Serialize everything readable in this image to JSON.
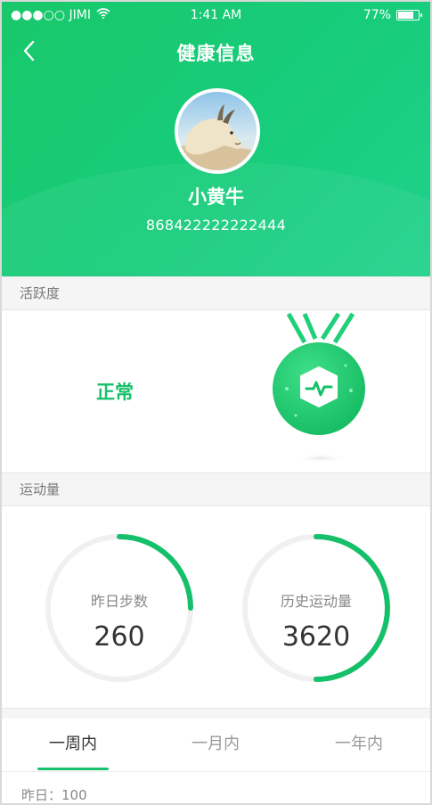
{
  "status_bar": {
    "carrier": "●●●○○ JIMI",
    "time": "1:41 AM",
    "battery": "77%",
    "battery_level": 0.77
  },
  "header": {
    "title": "健康信息",
    "back_icon": "chevron-left-icon"
  },
  "profile": {
    "name": "小黄牛",
    "id": "868422222222444",
    "avatar": "goat-avatar-image"
  },
  "activity": {
    "section_title": "活跃度",
    "status": "正常",
    "medal_icon": "pulse-medal-icon"
  },
  "exercise": {
    "section_title": "运动量",
    "rings": [
      {
        "label": "昨日步数",
        "value": "260",
        "progress": 0.25
      },
      {
        "label": "历史运动量",
        "value": "3620",
        "progress": 0.5
      }
    ]
  },
  "tabs": [
    {
      "label": "一周内",
      "active": true
    },
    {
      "label": "一月内",
      "active": false
    },
    {
      "label": "一年内",
      "active": false
    }
  ],
  "summary": "昨日：100",
  "colors": {
    "brand_green": "#16c06a",
    "ring_track": "#f0f0f0"
  }
}
